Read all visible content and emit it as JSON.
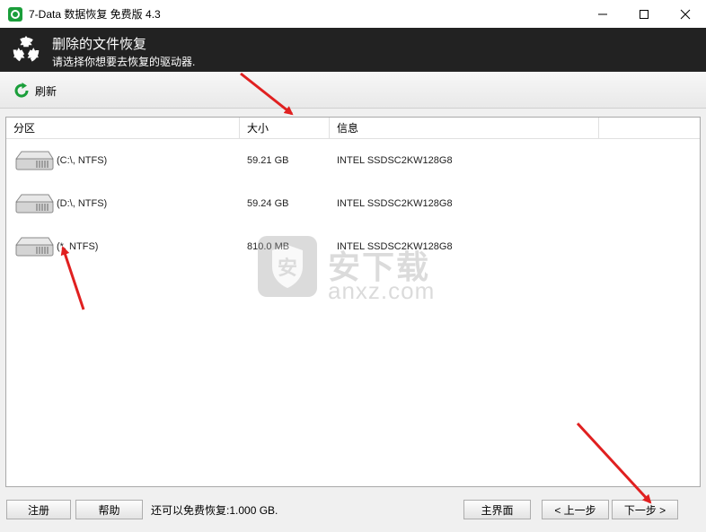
{
  "window": {
    "title": "7-Data 数据恢复 免费版 4.3",
    "minimize_glyph": "—",
    "maximize_glyph": "☐",
    "close_glyph": "✕"
  },
  "header": {
    "title": "删除的文件恢复",
    "subtitle": "请选择你想要去恢复的驱动器."
  },
  "toolbar": {
    "refresh_label": "刷新"
  },
  "table": {
    "columns": [
      "分区",
      "大小",
      "信息"
    ],
    "rows": [
      {
        "partition": "(C:\\, NTFS)",
        "size": "59.21 GB",
        "info": "INTEL SSDSC2KW128G8"
      },
      {
        "partition": "(D:\\, NTFS)",
        "size": "59.24 GB",
        "info": "INTEL SSDSC2KW128G8"
      },
      {
        "partition": "(*, NTFS)",
        "size": "810.0 MB",
        "info": "INTEL SSDSC2KW128G8"
      }
    ]
  },
  "watermark": {
    "cn": "安下载",
    "en": "anxz.com"
  },
  "footer": {
    "register_label": "注册",
    "help_label": "帮助",
    "free_text": "还可以免费恢复:1.000 GB.",
    "home_label": "主界面",
    "prev_label": "< 上一步",
    "next_label": "下一步 >"
  },
  "colors": {
    "header_bg": "#222222",
    "app_icon": "#1a9e3a",
    "refresh_icon": "#1a9e3a",
    "annotation_arrow": "#e02020"
  }
}
